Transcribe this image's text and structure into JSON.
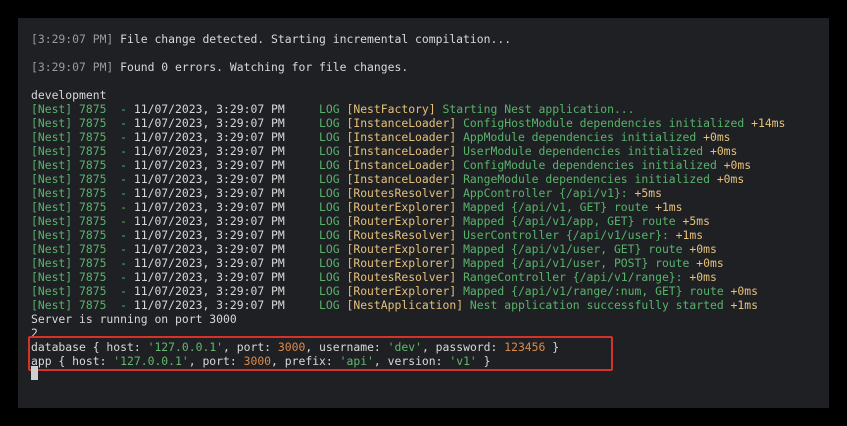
{
  "terminal": {
    "compile_lines": [
      {
        "time": "[3:29:07 PM]",
        "msg": " File change detected. Starting incremental compilation..."
      },
      {
        "time": "[3:29:07 PM]",
        "msg": " Found 0 errors. Watching for file changes."
      }
    ],
    "env_line": "development",
    "nest_lines": [
      {
        "prefix": "[Nest] 7875  - ",
        "ts": "11/07/2023, 3:29:07 PM",
        "lvl": "LOG",
        "ctx": "[NestFactory]",
        "msg": " Starting Nest application...",
        "dur": ""
      },
      {
        "prefix": "[Nest] 7875  - ",
        "ts": "11/07/2023, 3:29:07 PM",
        "lvl": "LOG",
        "ctx": "[InstanceLoader]",
        "msg": " ConfigHostModule dependencies initialized ",
        "dur": "+14ms"
      },
      {
        "prefix": "[Nest] 7875  - ",
        "ts": "11/07/2023, 3:29:07 PM",
        "lvl": "LOG",
        "ctx": "[InstanceLoader]",
        "msg": " AppModule dependencies initialized ",
        "dur": "+0ms"
      },
      {
        "prefix": "[Nest] 7875  - ",
        "ts": "11/07/2023, 3:29:07 PM",
        "lvl": "LOG",
        "ctx": "[InstanceLoader]",
        "msg": " UserModule dependencies initialized ",
        "dur": "+0ms"
      },
      {
        "prefix": "[Nest] 7875  - ",
        "ts": "11/07/2023, 3:29:07 PM",
        "lvl": "LOG",
        "ctx": "[InstanceLoader]",
        "msg": " ConfigModule dependencies initialized ",
        "dur": "+0ms"
      },
      {
        "prefix": "[Nest] 7875  - ",
        "ts": "11/07/2023, 3:29:07 PM",
        "lvl": "LOG",
        "ctx": "[InstanceLoader]",
        "msg": " RangeModule dependencies initialized ",
        "dur": "+0ms"
      },
      {
        "prefix": "[Nest] 7875  - ",
        "ts": "11/07/2023, 3:29:07 PM",
        "lvl": "LOG",
        "ctx": "[RoutesResolver]",
        "msg": " AppController {/api/v1}: ",
        "dur": "+5ms"
      },
      {
        "prefix": "[Nest] 7875  - ",
        "ts": "11/07/2023, 3:29:07 PM",
        "lvl": "LOG",
        "ctx": "[RouterExplorer]",
        "msg": " Mapped {/api/v1, GET} route ",
        "dur": "+1ms"
      },
      {
        "prefix": "[Nest] 7875  - ",
        "ts": "11/07/2023, 3:29:07 PM",
        "lvl": "LOG",
        "ctx": "[RouterExplorer]",
        "msg": " Mapped {/api/v1/app, GET} route ",
        "dur": "+5ms"
      },
      {
        "prefix": "[Nest] 7875  - ",
        "ts": "11/07/2023, 3:29:07 PM",
        "lvl": "LOG",
        "ctx": "[RoutesResolver]",
        "msg": " UserController {/api/v1/user}: ",
        "dur": "+1ms"
      },
      {
        "prefix": "[Nest] 7875  - ",
        "ts": "11/07/2023, 3:29:07 PM",
        "lvl": "LOG",
        "ctx": "[RouterExplorer]",
        "msg": " Mapped {/api/v1/user, GET} route ",
        "dur": "+0ms"
      },
      {
        "prefix": "[Nest] 7875  - ",
        "ts": "11/07/2023, 3:29:07 PM",
        "lvl": "LOG",
        "ctx": "[RouterExplorer]",
        "msg": " Mapped {/api/v1/user, POST} route ",
        "dur": "+0ms"
      },
      {
        "prefix": "[Nest] 7875  - ",
        "ts": "11/07/2023, 3:29:07 PM",
        "lvl": "LOG",
        "ctx": "[RoutesResolver]",
        "msg": " RangeController {/api/v1/range}: ",
        "dur": "+0ms"
      },
      {
        "prefix": "[Nest] 7875  - ",
        "ts": "11/07/2023, 3:29:07 PM",
        "lvl": "LOG",
        "ctx": "[RouterExplorer]",
        "msg": " Mapped {/api/v1/range/:num, GET} route ",
        "dur": "+0ms"
      },
      {
        "prefix": "[Nest] 7875  - ",
        "ts": "11/07/2023, 3:29:07 PM",
        "lvl": "LOG",
        "ctx": "[NestApplication]",
        "msg": " Nest application successfully started ",
        "dur": "+1ms"
      }
    ],
    "server_line": "Server is running on port 3000",
    "number_line": "2",
    "database_line": {
      "a": "database { host: ",
      "host": "'127.0.0.1'",
      "b": ", port: ",
      "port": "3000",
      "c": ", username: ",
      "username": "'dev'",
      "d": ", password: ",
      "password": "123456",
      "e": " }"
    },
    "app_line": {
      "a": "app { host: ",
      "host": "'127.0.0.1'",
      "b": ", port: ",
      "port": "3000",
      "c": ", prefix: ",
      "prefix": "'api'",
      "d": ", version: ",
      "version": "'v1'",
      "e": " }"
    }
  },
  "colors": {
    "background": "#1f2024",
    "nest_green": "#58b36b",
    "context_yellow": "#e5c07b",
    "duration_orange": "#d98a4e",
    "highlight_red": "#d6322a"
  }
}
